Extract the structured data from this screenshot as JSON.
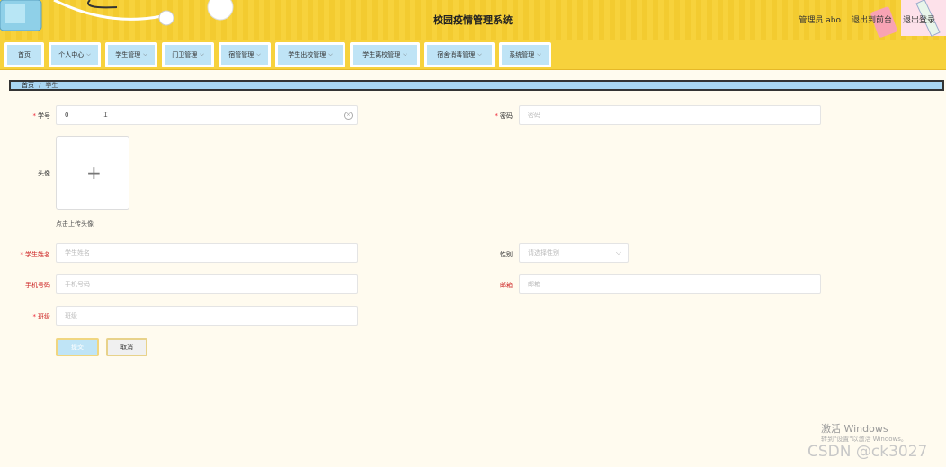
{
  "header": {
    "title": "校园疫情管理系统",
    "user_label": "管理员 abo",
    "back_label": "退出到前台",
    "logout_label": "退出登录"
  },
  "nav": {
    "items": [
      {
        "label": "首页",
        "has_dropdown": false
      },
      {
        "label": "个人中心",
        "has_dropdown": true
      },
      {
        "label": "学生管理",
        "has_dropdown": true
      },
      {
        "label": "门卫管理",
        "has_dropdown": true
      },
      {
        "label": "宿管管理",
        "has_dropdown": true
      },
      {
        "label": "学生出校管理",
        "has_dropdown": true
      },
      {
        "label": "学生离校管理",
        "has_dropdown": true
      },
      {
        "label": "宿舍消毒管理",
        "has_dropdown": true
      },
      {
        "label": "系统管理",
        "has_dropdown": true
      }
    ]
  },
  "breadcrumb": {
    "home": "首页",
    "separator": "/",
    "current": "学生"
  },
  "form": {
    "student_id": {
      "label": "学号",
      "value": "0",
      "required": true
    },
    "password": {
      "label": "密码",
      "placeholder": "密码",
      "required": true
    },
    "avatar": {
      "label": "头像",
      "hint": "点击上传头像"
    },
    "name": {
      "label": "学生姓名",
      "placeholder": "学生姓名",
      "required": true
    },
    "gender": {
      "label": "性别",
      "placeholder": "请选择性别"
    },
    "phone": {
      "label": "手机号码",
      "placeholder": "手机号码"
    },
    "email": {
      "label": "邮箱",
      "placeholder": "邮箱"
    },
    "class": {
      "label": "班级",
      "placeholder": "班级",
      "required": true
    },
    "submit_label": "提交",
    "cancel_label": "取消"
  },
  "watermark": {
    "activate_title": "激活 Windows",
    "activate_sub": "转到\"设置\"以激活 Windows。",
    "csdn": "CSDN @ck3027"
  },
  "colors": {
    "header_bg": "#f7d23c",
    "nav_item_bg": "#bfe4f6",
    "page_bg": "#fffbef",
    "required": "#e22233"
  }
}
